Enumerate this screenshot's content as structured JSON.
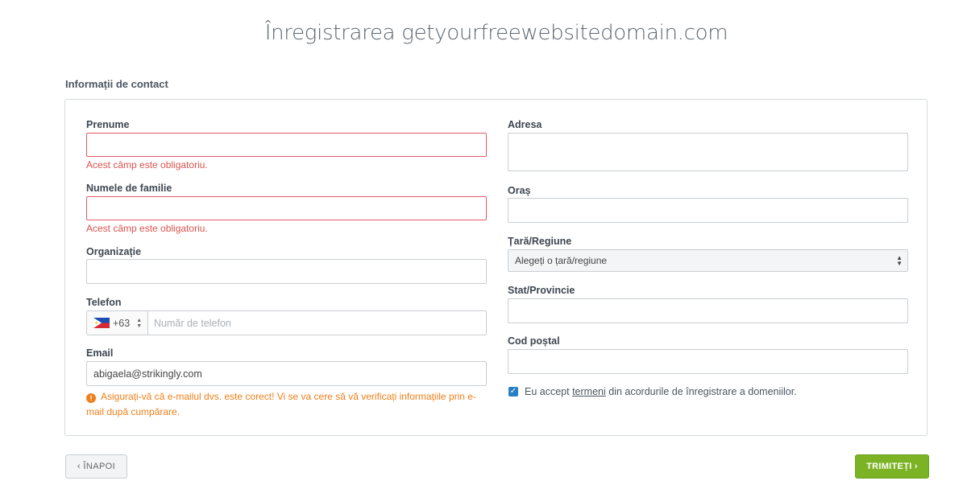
{
  "page": {
    "title": "Înregistrarea getyourfreewebsitedomain.com",
    "section_title": "Informații de contact"
  },
  "form": {
    "first_name": {
      "label": "Prenume",
      "value": "",
      "error": "Acest câmp este obligatoriu."
    },
    "last_name": {
      "label": "Numele de familie",
      "value": "",
      "error": "Acest câmp este obligatoriu."
    },
    "organization": {
      "label": "Organizație",
      "value": ""
    },
    "phone": {
      "label": "Telefon",
      "country_code": "+63",
      "flag": "philippines-flag-icon",
      "placeholder": "Număr de telefon",
      "value": ""
    },
    "email": {
      "label": "Email",
      "value": "abigaela@strikingly.com",
      "warning_icon": "warning-icon",
      "warning": "Asigurați-vă că e-mailul dvs. este corect! Vi se va cere să vă verificați informațiile prin e-mail după cumpărare."
    },
    "address": {
      "label": "Adresa",
      "value": ""
    },
    "city": {
      "label": "Oraș",
      "value": ""
    },
    "country": {
      "label": "Țară/Regiune",
      "selected": "Alegeți o țară/regiune"
    },
    "state": {
      "label": "Stat/Provincie",
      "value": ""
    },
    "postal": {
      "label": "Cod poștal",
      "value": ""
    },
    "terms": {
      "checked": true,
      "prefix": "Eu accept ",
      "link": "termeni",
      "suffix": " din acordurile de înregistrare a domeniilor."
    }
  },
  "buttons": {
    "back": "‹ ÎNAPOI",
    "submit": "TRIMITEȚI ›"
  },
  "colors": {
    "error": "#d9534f",
    "warning": "#ef7f1a",
    "submit_bg": "#7bb324",
    "checkbox": "#2a7ec6"
  }
}
